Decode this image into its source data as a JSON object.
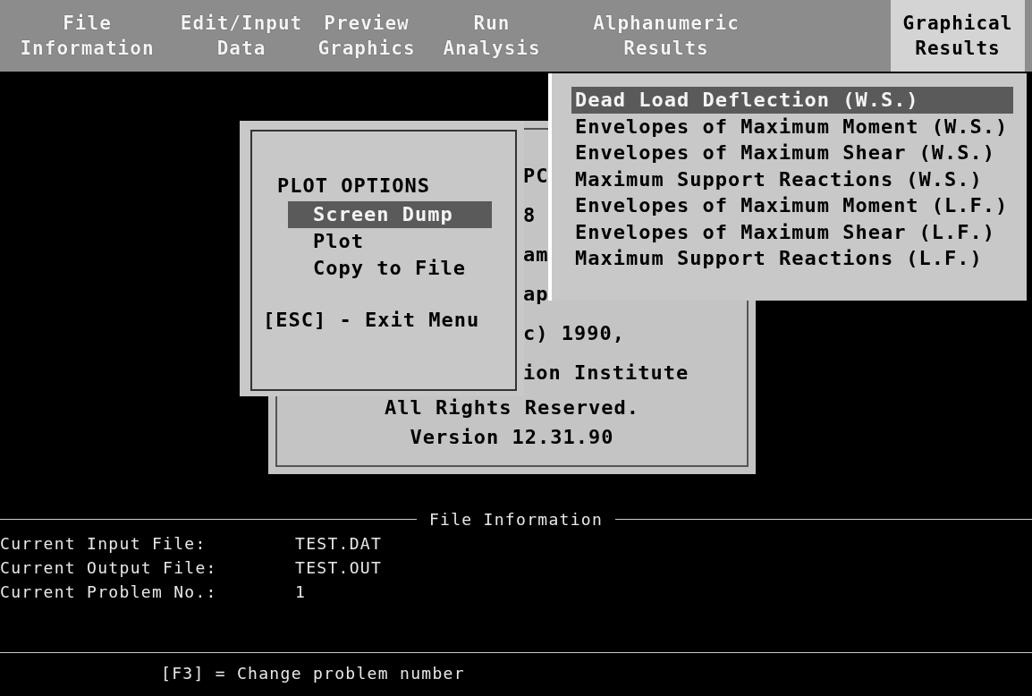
{
  "menu_bar": {
    "items": [
      {
        "line_1": "File",
        "line_2": "Information",
        "selected": false
      },
      {
        "line_1": "Edit/Input",
        "line_2": "Data",
        "selected": false
      },
      {
        "line_1": "Preview",
        "line_2": "Graphics",
        "selected": false
      },
      {
        "line_1": "Run",
        "line_2": "Analysis",
        "selected": false
      },
      {
        "line_1": "Alphanumeric",
        "line_2": "Results",
        "selected": false
      },
      {
        "line_1": "Graphical",
        "line_2": "Results",
        "selected": true
      }
    ]
  },
  "about_dialog": {
    "partial_lines": [
      "PC",
      "8",
      "am",
      "ap",
      "c) 1990,",
      "ion Institute"
    ],
    "lines": [
      "All Rights Reserved.",
      "Version 12.31.90"
    ]
  },
  "plot_options": {
    "title": "PLOT OPTIONS",
    "items": [
      {
        "label": "Screen Dump",
        "selected": true
      },
      {
        "label": "Plot",
        "selected": false
      },
      {
        "label": "Copy to File",
        "selected": false
      }
    ],
    "footer": "[ESC] - Exit Menu"
  },
  "graphical_results_menu": {
    "items": [
      {
        "label": "Dead Load Deflection (W.S.)",
        "selected": true
      },
      {
        "label": "Envelopes of Maximum Moment (W.S.)",
        "selected": false
      },
      {
        "label": "Envelopes of Maximum Shear (W.S.)",
        "selected": false
      },
      {
        "label": "Maximum Support Reactions (W.S.)",
        "selected": false
      },
      {
        "label": "Envelopes of Maximum Moment (L.F.)",
        "selected": false
      },
      {
        "label": "Envelopes of Maximum Shear (L.F.)",
        "selected": false
      },
      {
        "label": "Maximum Support Reactions (L.F.)",
        "selected": false
      }
    ]
  },
  "file_information": {
    "title": "File Information",
    "rows": [
      {
        "label": "Current Input File:",
        "value": "TEST.DAT"
      },
      {
        "label": "Current Output File:",
        "value": "TEST.OUT"
      },
      {
        "label": "Current Problem No.:",
        "value": "1"
      }
    ]
  },
  "status_bar": {
    "hint": "[F3] = Change problem number"
  }
}
